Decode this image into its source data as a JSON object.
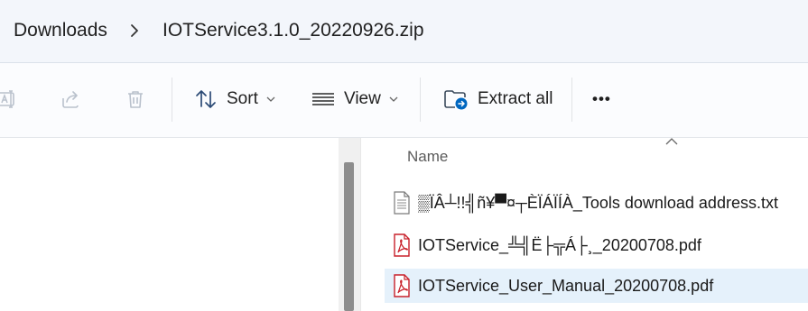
{
  "breadcrumb": {
    "items": [
      "Downloads",
      "IOTService3.1.0_20220926.zip"
    ]
  },
  "toolbar": {
    "sort_label": "Sort",
    "view_label": "View",
    "extract_label": "Extract all",
    "more_label": "•••"
  },
  "filelist": {
    "column_name": "Name",
    "files": [
      {
        "name": "▒ÏÂ┴!!╣ñ¥▀¤┬ÈÏÁÏÍÀ_Tools download address.txt",
        "icon": "text-file-icon"
      },
      {
        "name": "IOTService_╩╣Ë├╦Á├¸_20200708.pdf",
        "icon": "pdf-file-icon"
      },
      {
        "name": "IOTService_User_Manual_20200708.pdf",
        "icon": "pdf-file-icon",
        "selected": true
      }
    ]
  },
  "colors": {
    "address_bg": "#f3f6fb",
    "toolbar_bg": "#fbfcfe",
    "selection_bg": "#e5f1fb",
    "pdf_red": "#c8202a",
    "accent_blue": "#0067c0"
  }
}
